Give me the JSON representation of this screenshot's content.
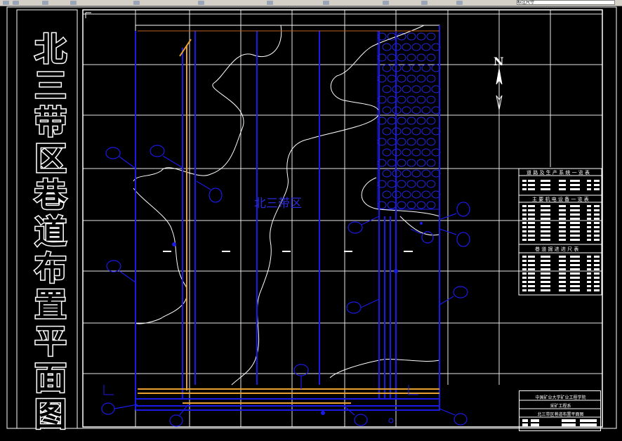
{
  "toolbar": {
    "layer_box_value": "标注尺寸"
  },
  "drawing": {
    "vertical_title": [
      "北",
      "三",
      "带",
      "区",
      "巷",
      "道",
      "布",
      "置",
      "平",
      "面",
      "图"
    ],
    "region_label": "北三带区",
    "north_label": "N",
    "legend_table_titles": [
      "道 路 及 生 产 系 统 一 览 表",
      "主 要 机 电 设 备 一 览 表",
      "巷 道 掘 进 进 尺 表"
    ],
    "title_block": {
      "line1": "中国矿业大学矿业工程学院",
      "line2": "采矿工程系",
      "line3": "北三带区巷道布置平面图"
    },
    "colors": {
      "background": "#000000",
      "grid": "#ffffff",
      "roadway_blue": "#1a1ae6",
      "roadway_orange": "#e8a030",
      "boundary": "#ffffff",
      "goaf_hatch": "#2020d0"
    }
  }
}
